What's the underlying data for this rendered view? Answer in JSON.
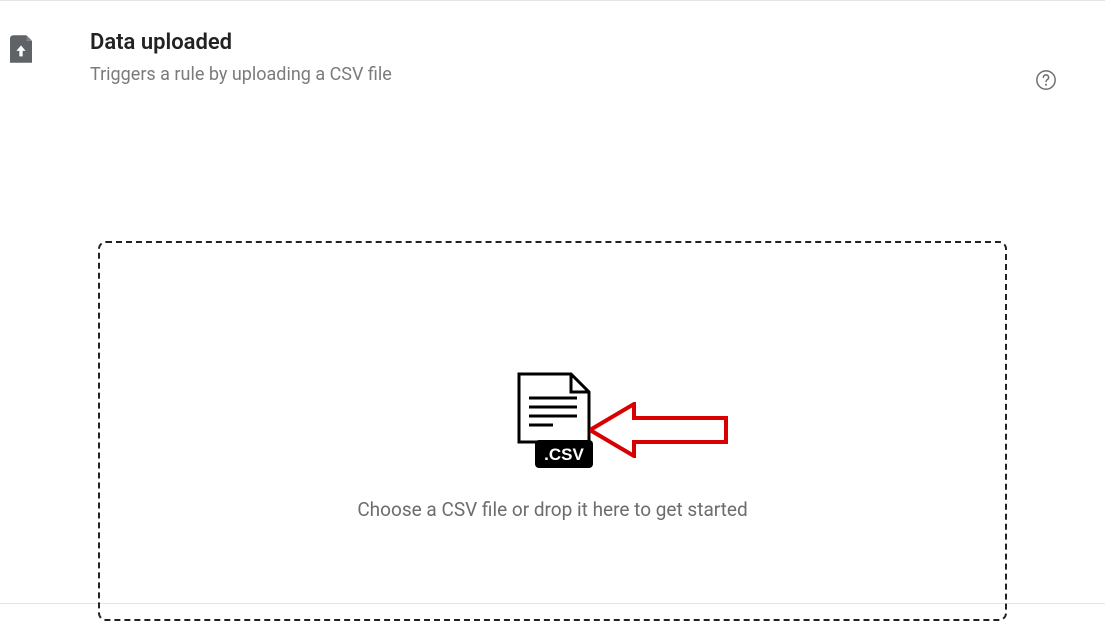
{
  "header": {
    "title": "Data uploaded",
    "subtitle": "Triggers a rule by uploading a CSV file"
  },
  "dropzone": {
    "instruction": "Choose a CSV file or drop it here to get started",
    "csv_label": ".CSV"
  }
}
